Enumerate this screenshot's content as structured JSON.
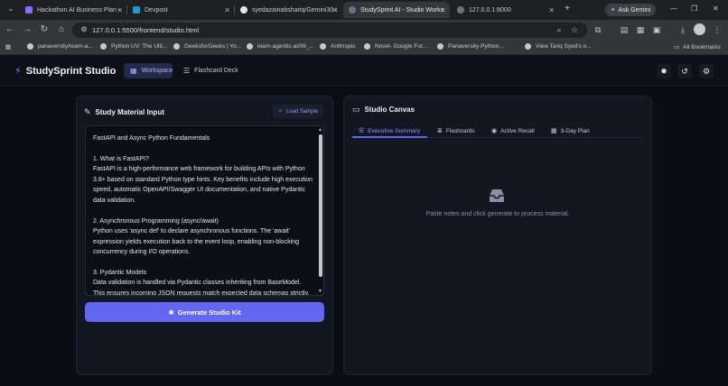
{
  "browser": {
    "tabs": [
      {
        "title": "Hackathon AI Business Plan -",
        "favicon_color": "#8f6bff"
      },
      {
        "title": "Devpost",
        "favicon_color": "#1d9bd1"
      },
      {
        "title": "syedazainabshariq/Gemini30 t",
        "favicon_color": "#e6e6e6"
      },
      {
        "title": "StudySprint AI - Studio Works",
        "favicon_color": "#6c7280"
      },
      {
        "title": "127.0.0.1:8000",
        "favicon_color": "#6c7280"
      }
    ],
    "url": "127.0.0.1:5500/frontend/studio.html",
    "ask_gemini": "Ask Gemini",
    "bookmarks": [
      "panaversity/learn-a...",
      "Python UV: The Ulti...",
      "GeeksforGeeks | Yo...",
      "learn-agentic-ai/06_...",
      "Anthropic",
      "Novel- Google For...",
      "Panaversity-Python...",
      "View Tariq Syed's o..."
    ],
    "all_bookmarks": "All Bookmarks"
  },
  "app": {
    "brand": "StudySprint Studio",
    "nav": [
      {
        "label": "Workspace",
        "icon": "grid-icon"
      },
      {
        "label": "Flashcard Deck",
        "icon": "layers-icon"
      }
    ],
    "header_icons": [
      "sun-icon",
      "history-icon",
      "settings-icon"
    ]
  },
  "input_panel": {
    "title": "Study Material Input",
    "load_sample": "Load Sample",
    "content": "FastAPI and Async Python Fundamentals\n\n1. What is FastAPI?\nFastAPI is a high-performance web framework for building APIs with Python 3.8+ based on standard Python type hints. Key benefits include high execution speed, automatic OpenAPI/Swagger UI documentation, and native Pydantic data validation.\n\n2. Asynchronous Programming (async/await)\nPython uses 'async def' to declare asynchronous functions. The 'await' expression yields execution back to the event loop, enabling non-blocking concurrency during I/O operations.\n\n3. Pydantic Models\nData validation is handled via Pydantic classes inheriting from BaseModel. This ensures incoming JSON requests match expected data schemas strictly.",
    "generate": "Generate Studio Kit"
  },
  "canvas_panel": {
    "title": "Studio Canvas",
    "tabs": [
      {
        "label": "Executive Summary",
        "icon": "list-icon",
        "active": true
      },
      {
        "label": "Flashcards",
        "icon": "layers-icon",
        "active": false
      },
      {
        "label": "Active Recall",
        "icon": "question-icon",
        "active": false
      },
      {
        "label": "3-Day Plan",
        "icon": "calendar-icon",
        "active": false
      }
    ],
    "empty_message": "Paste notes and click generate to process material."
  },
  "colors": {
    "accent": "#6366f1",
    "accent_text": "#8f97ff",
    "background": "#0b0d14",
    "panel": "#131722"
  }
}
